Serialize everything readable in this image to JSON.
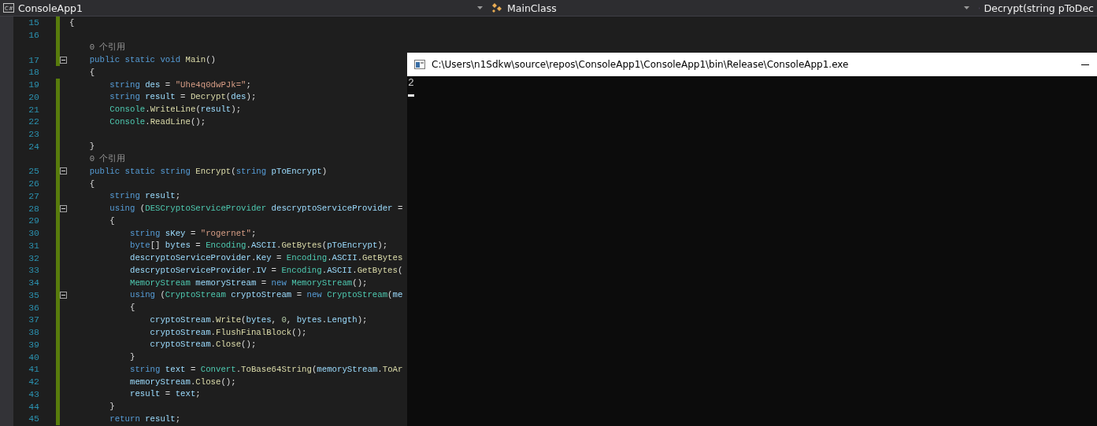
{
  "nav_bar": [
    {
      "kind": "project",
      "icon_text": "C#",
      "label": "ConsoleApp1"
    },
    {
      "kind": "class",
      "label": "MainClass"
    },
    {
      "kind": "member",
      "label": "Decrypt(string pToDec"
    }
  ],
  "editor": {
    "lines": [
      {
        "kind": "code",
        "number": "15",
        "modified": true,
        "fold": false,
        "segments": [
          {
            "kind": "p",
            "text": "{"
          }
        ]
      },
      {
        "kind": "code",
        "number": "16",
        "modified": true,
        "fold": false
      },
      {
        "kind": "lens",
        "modified": true,
        "text": "    0 个引用"
      },
      {
        "kind": "code",
        "number": "17",
        "modified": true,
        "fold": true,
        "segments": [
          {
            "kind": "kw",
            "text": "    public static void"
          },
          {
            "kind": "m",
            "text": " Main"
          },
          {
            "kind": "p",
            "text": "()"
          }
        ]
      },
      {
        "kind": "code",
        "number": "18",
        "modified": false,
        "fold": false,
        "segments": [
          {
            "kind": "p",
            "text": "    {"
          }
        ]
      },
      {
        "kind": "code",
        "number": "19",
        "modified": true,
        "fold": false,
        "segments": [
          {
            "kind": "kw",
            "text": "        string"
          },
          {
            "kind": "id",
            "text": " des"
          },
          {
            "kind": "p",
            "text": " = "
          },
          {
            "kind": "s",
            "text": "\"Uhe4q0dwPJk=\""
          },
          {
            "kind": "p",
            "text": ";"
          }
        ]
      },
      {
        "kind": "code",
        "number": "20",
        "modified": true,
        "fold": false,
        "segments": [
          {
            "kind": "kw",
            "text": "        string"
          },
          {
            "kind": "id",
            "text": " result"
          },
          {
            "kind": "p",
            "text": " = "
          },
          {
            "kind": "m",
            "text": "Decrypt"
          },
          {
            "kind": "p",
            "text": "("
          },
          {
            "kind": "id",
            "text": "des"
          },
          {
            "kind": "p",
            "text": ");"
          }
        ]
      },
      {
        "kind": "code",
        "number": "21",
        "modified": true,
        "fold": false,
        "segments": [
          {
            "kind": "t",
            "text": "        Console"
          },
          {
            "kind": "p",
            "text": "."
          },
          {
            "kind": "m",
            "text": "WriteLine"
          },
          {
            "kind": "p",
            "text": "("
          },
          {
            "kind": "id",
            "text": "result"
          },
          {
            "kind": "p",
            "text": ");"
          }
        ]
      },
      {
        "kind": "code",
        "number": "22",
        "modified": true,
        "fold": false,
        "segments": [
          {
            "kind": "t",
            "text": "        Console"
          },
          {
            "kind": "p",
            "text": "."
          },
          {
            "kind": "m",
            "text": "ReadLine"
          },
          {
            "kind": "p",
            "text": "();"
          }
        ]
      },
      {
        "kind": "code",
        "number": "23",
        "modified": true,
        "fold": false
      },
      {
        "kind": "code",
        "number": "24",
        "modified": true,
        "fold": false,
        "segments": [
          {
            "kind": "p",
            "text": "    }"
          }
        ]
      },
      {
        "kind": "lens",
        "modified": true,
        "text": "    0 个引用"
      },
      {
        "kind": "code",
        "number": "25",
        "modified": true,
        "fold": true,
        "segments": [
          {
            "kind": "kw",
            "text": "    public static string"
          },
          {
            "kind": "m",
            "text": " Encrypt"
          },
          {
            "kind": "p",
            "text": "("
          },
          {
            "kind": "kw",
            "text": "string"
          },
          {
            "kind": "id",
            "text": " pToEncrypt"
          },
          {
            "kind": "p",
            "text": ")"
          }
        ]
      },
      {
        "kind": "code",
        "number": "26",
        "modified": true,
        "fold": false,
        "segments": [
          {
            "kind": "p",
            "text": "    {"
          }
        ]
      },
      {
        "kind": "code",
        "number": "27",
        "modified": true,
        "fold": false,
        "segments": [
          {
            "kind": "kw",
            "text": "        string"
          },
          {
            "kind": "id",
            "text": " result"
          },
          {
            "kind": "p",
            "text": ";"
          }
        ]
      },
      {
        "kind": "code",
        "number": "28",
        "modified": true,
        "fold": true,
        "segments": [
          {
            "kind": "kw",
            "text": "        using"
          },
          {
            "kind": "p",
            "text": " ("
          },
          {
            "kind": "t",
            "text": "DESCryptoServiceProvider"
          },
          {
            "kind": "id",
            "text": " descryptoServiceProvider"
          },
          {
            "kind": "p",
            "text": " ="
          }
        ]
      },
      {
        "kind": "code",
        "number": "29",
        "modified": true,
        "fold": false,
        "segments": [
          {
            "kind": "p",
            "text": "        {"
          }
        ]
      },
      {
        "kind": "code",
        "number": "30",
        "modified": true,
        "fold": false,
        "segments": [
          {
            "kind": "kw",
            "text": "            string"
          },
          {
            "kind": "id",
            "text": " sKey"
          },
          {
            "kind": "p",
            "text": " = "
          },
          {
            "kind": "s",
            "text": "\"rogernet\""
          },
          {
            "kind": "p",
            "text": ";"
          }
        ]
      },
      {
        "kind": "code",
        "number": "31",
        "modified": true,
        "fold": false,
        "segments": [
          {
            "kind": "kw",
            "text": "            byte"
          },
          {
            "kind": "p",
            "text": "[]"
          },
          {
            "kind": "id",
            "text": " bytes"
          },
          {
            "kind": "p",
            "text": " = "
          },
          {
            "kind": "t",
            "text": "Encoding"
          },
          {
            "kind": "p",
            "text": "."
          },
          {
            "kind": "id",
            "text": "ASCII"
          },
          {
            "kind": "p",
            "text": "."
          },
          {
            "kind": "m",
            "text": "GetBytes"
          },
          {
            "kind": "p",
            "text": "("
          },
          {
            "kind": "id",
            "text": "pToEncrypt"
          },
          {
            "kind": "p",
            "text": ");"
          }
        ]
      },
      {
        "kind": "code",
        "number": "32",
        "modified": true,
        "fold": false,
        "segments": [
          {
            "kind": "id",
            "text": "            descryptoServiceProvider"
          },
          {
            "kind": "p",
            "text": "."
          },
          {
            "kind": "id",
            "text": "Key"
          },
          {
            "kind": "p",
            "text": " = "
          },
          {
            "kind": "t",
            "text": "Encoding"
          },
          {
            "kind": "p",
            "text": "."
          },
          {
            "kind": "id",
            "text": "ASCII"
          },
          {
            "kind": "p",
            "text": "."
          },
          {
            "kind": "m",
            "text": "GetBytes"
          }
        ]
      },
      {
        "kind": "code",
        "number": "33",
        "modified": true,
        "fold": false,
        "segments": [
          {
            "kind": "id",
            "text": "            descryptoServiceProvider"
          },
          {
            "kind": "p",
            "text": "."
          },
          {
            "kind": "id",
            "text": "IV"
          },
          {
            "kind": "p",
            "text": " = "
          },
          {
            "kind": "t",
            "text": "Encoding"
          },
          {
            "kind": "p",
            "text": "."
          },
          {
            "kind": "id",
            "text": "ASCII"
          },
          {
            "kind": "p",
            "text": "."
          },
          {
            "kind": "m",
            "text": "GetBytes"
          },
          {
            "kind": "p",
            "text": "("
          }
        ]
      },
      {
        "kind": "code",
        "number": "34",
        "modified": true,
        "fold": false,
        "segments": [
          {
            "kind": "t",
            "text": "            MemoryStream"
          },
          {
            "kind": "id",
            "text": " memoryStream"
          },
          {
            "kind": "p",
            "text": " = "
          },
          {
            "kind": "kw",
            "text": "new"
          },
          {
            "kind": "t",
            "text": " MemoryStream"
          },
          {
            "kind": "p",
            "text": "();"
          }
        ]
      },
      {
        "kind": "code",
        "number": "35",
        "modified": true,
        "fold": true,
        "segments": [
          {
            "kind": "kw",
            "text": "            using"
          },
          {
            "kind": "p",
            "text": " ("
          },
          {
            "kind": "t",
            "text": "CryptoStream"
          },
          {
            "kind": "id",
            "text": " cryptoStream"
          },
          {
            "kind": "p",
            "text": " = "
          },
          {
            "kind": "kw",
            "text": "new"
          },
          {
            "kind": "t",
            "text": " CryptoStream"
          },
          {
            "kind": "p",
            "text": "("
          },
          {
            "kind": "id",
            "text": "me"
          }
        ]
      },
      {
        "kind": "code",
        "number": "36",
        "modified": true,
        "fold": false,
        "segments": [
          {
            "kind": "p",
            "text": "            {"
          }
        ]
      },
      {
        "kind": "code",
        "number": "37",
        "modified": true,
        "fold": false,
        "segments": [
          {
            "kind": "id",
            "text": "                cryptoStream"
          },
          {
            "kind": "p",
            "text": "."
          },
          {
            "kind": "m",
            "text": "Write"
          },
          {
            "kind": "p",
            "text": "("
          },
          {
            "kind": "id",
            "text": "bytes"
          },
          {
            "kind": "p",
            "text": ", "
          },
          {
            "kind": "n",
            "text": "0"
          },
          {
            "kind": "p",
            "text": ", "
          },
          {
            "kind": "id",
            "text": "bytes"
          },
          {
            "kind": "p",
            "text": "."
          },
          {
            "kind": "id",
            "text": "Length"
          },
          {
            "kind": "p",
            "text": ");"
          }
        ]
      },
      {
        "kind": "code",
        "number": "38",
        "modified": true,
        "fold": false,
        "segments": [
          {
            "kind": "id",
            "text": "                cryptoStream"
          },
          {
            "kind": "p",
            "text": "."
          },
          {
            "kind": "m",
            "text": "FlushFinalBlock"
          },
          {
            "kind": "p",
            "text": "();"
          }
        ]
      },
      {
        "kind": "code",
        "number": "39",
        "modified": true,
        "fold": false,
        "segments": [
          {
            "kind": "id",
            "text": "                cryptoStream"
          },
          {
            "kind": "p",
            "text": "."
          },
          {
            "kind": "m",
            "text": "Close"
          },
          {
            "kind": "p",
            "text": "();"
          }
        ]
      },
      {
        "kind": "code",
        "number": "40",
        "modified": true,
        "fold": false,
        "segments": [
          {
            "kind": "p",
            "text": "            }"
          }
        ]
      },
      {
        "kind": "code",
        "number": "41",
        "modified": true,
        "fold": false,
        "segments": [
          {
            "kind": "kw",
            "text": "            string"
          },
          {
            "kind": "id",
            "text": " text"
          },
          {
            "kind": "p",
            "text": " = "
          },
          {
            "kind": "t",
            "text": "Convert"
          },
          {
            "kind": "p",
            "text": "."
          },
          {
            "kind": "m",
            "text": "ToBase64String"
          },
          {
            "kind": "p",
            "text": "("
          },
          {
            "kind": "id",
            "text": "memoryStream"
          },
          {
            "kind": "p",
            "text": "."
          },
          {
            "kind": "m",
            "text": "ToAr"
          }
        ]
      },
      {
        "kind": "code",
        "number": "42",
        "modified": true,
        "fold": false,
        "segments": [
          {
            "kind": "id",
            "text": "            memoryStream"
          },
          {
            "kind": "p",
            "text": "."
          },
          {
            "kind": "m",
            "text": "Close"
          },
          {
            "kind": "p",
            "text": "();"
          }
        ]
      },
      {
        "kind": "code",
        "number": "43",
        "modified": true,
        "fold": false,
        "segments": [
          {
            "kind": "id",
            "text": "            result"
          },
          {
            "kind": "p",
            "text": " = "
          },
          {
            "kind": "id",
            "text": "text"
          },
          {
            "kind": "p",
            "text": ";"
          }
        ]
      },
      {
        "kind": "code",
        "number": "44",
        "modified": true,
        "fold": false,
        "segments": [
          {
            "kind": "p",
            "text": "        }"
          }
        ]
      },
      {
        "kind": "code",
        "number": "45",
        "modified": true,
        "fold": false,
        "segments": [
          {
            "kind": "kw",
            "text": "        return"
          },
          {
            "kind": "id",
            "text": " result"
          },
          {
            "kind": "p",
            "text": ";"
          }
        ]
      }
    ]
  },
  "console_window": {
    "title": "C:\\Users\\n1Sdkw\\source\\repos\\ConsoleApp1\\ConsoleApp1\\bin\\Release\\ConsoleApp1.exe",
    "output": "2"
  }
}
